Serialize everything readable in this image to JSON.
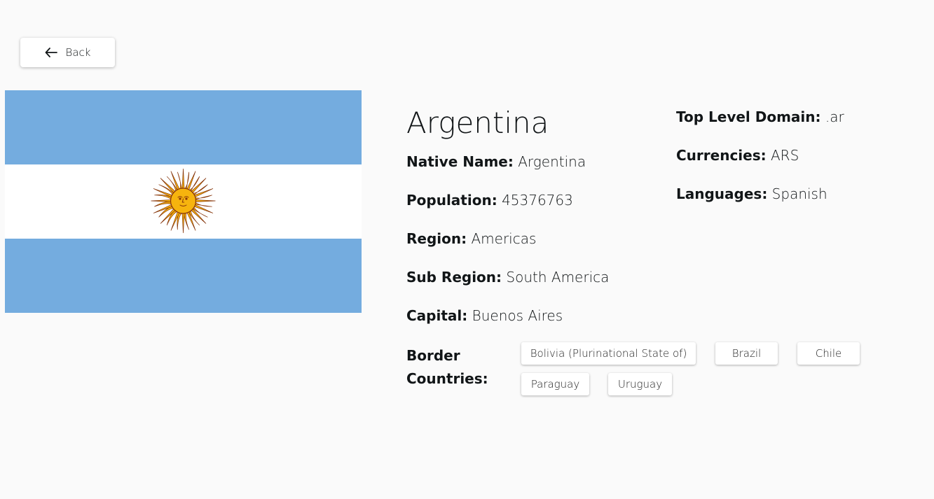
{
  "back": {
    "label": "Back",
    "icon": "arrow-left-icon"
  },
  "flag": {
    "alt": "Flag of Argentina",
    "colors": {
      "blue": "#74acdf",
      "white": "#ffffff",
      "sun": "#f6b40e",
      "sun_outline": "#85340a"
    }
  },
  "country": {
    "name": "Argentina",
    "labels": {
      "native_name": "Native Name:",
      "population": "Population:",
      "region": "Region:",
      "sub_region": "Sub Region:",
      "capital": "Capital:",
      "tld": "Top Level Domain:",
      "currencies": "Currencies:",
      "languages": "Languages:",
      "border_countries": "Border Countries:"
    },
    "native_name": "Argentina",
    "population": "45376763",
    "region": "Americas",
    "sub_region": "South America",
    "capital": "Buenos Aires",
    "tld": ".ar",
    "currencies": "ARS",
    "languages": "Spanish",
    "borders": [
      "Bolivia (Plurinational State of)",
      "Brazil",
      "Chile",
      "Paraguay",
      "Uruguay"
    ]
  }
}
